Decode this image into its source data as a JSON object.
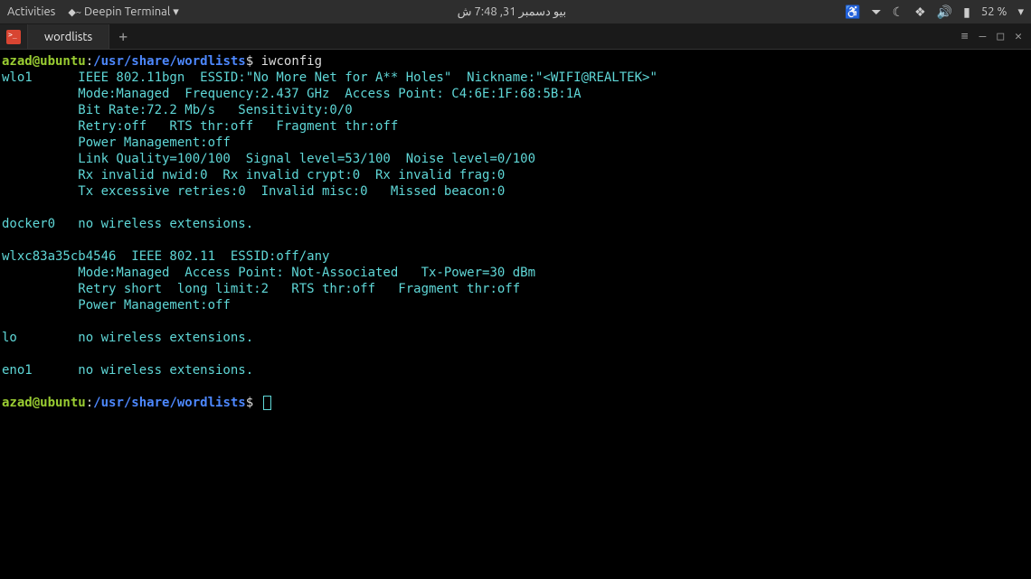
{
  "topbar": {
    "activities": "Activities",
    "app_name": "Deepin Terminal",
    "clock": "بيو دسمبر 31, 7:48 ش",
    "battery": "52 %"
  },
  "tabs": {
    "active": "wordlists"
  },
  "terminal": {
    "prompt_user": "azad@ubuntu",
    "prompt_colon": ":",
    "prompt_path": "/usr/share/wordlists",
    "prompt_sym": "$",
    "cmd1": "iwconfig",
    "lines": [
      "wlo1      IEEE 802.11bgn  ESSID:\"No More Net for A** Holes\"  Nickname:\"<WIFI@REALTEK>\"",
      "          Mode:Managed  Frequency:2.437 GHz  Access Point: C4:6E:1F:68:5B:1A   ",
      "          Bit Rate:72.2 Mb/s   Sensitivity:0/0  ",
      "          Retry:off   RTS thr:off   Fragment thr:off",
      "          Power Management:off",
      "          Link Quality=100/100  Signal level=53/100  Noise level=0/100",
      "          Rx invalid nwid:0  Rx invalid crypt:0  Rx invalid frag:0",
      "          Tx excessive retries:0  Invalid misc:0   Missed beacon:0",
      "",
      "docker0   no wireless extensions.",
      "",
      "wlxc83a35cb4546  IEEE 802.11  ESSID:off/any  ",
      "          Mode:Managed  Access Point: Not-Associated   Tx-Power=30 dBm   ",
      "          Retry short  long limit:2   RTS thr:off   Fragment thr:off",
      "          Power Management:off",
      "          ",
      "lo        no wireless extensions.",
      "",
      "eno1      no wireless extensions.",
      ""
    ]
  }
}
